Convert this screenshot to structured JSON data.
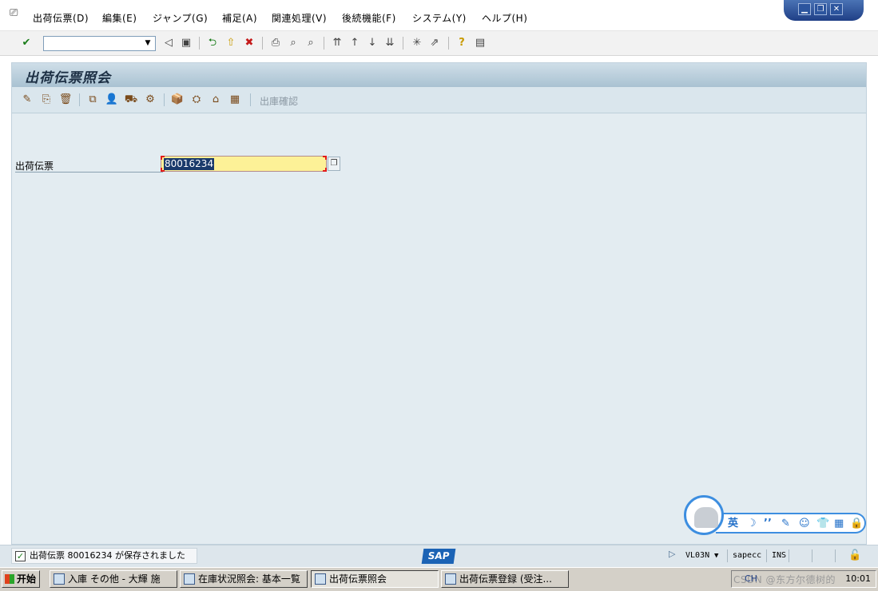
{
  "menubar": {
    "system_icon": "window-menu-icon",
    "items": [
      {
        "label": "出荷伝票(D)"
      },
      {
        "label": "編集(E)"
      },
      {
        "label": "ジャンプ(G)"
      },
      {
        "label": "補足(A)"
      },
      {
        "label": "関連処理(V)"
      },
      {
        "label": "後続機能(F)"
      },
      {
        "label": "システム(Y)"
      },
      {
        "label": "ヘルプ(H)"
      }
    ],
    "window_controls": {
      "minimize": "▁",
      "restore": "❐",
      "close": "✕"
    }
  },
  "toolbar": {
    "enter": "✔",
    "command_value": "",
    "dropdown_arrow": "▼",
    "back_triangle": "◁",
    "save": "▣",
    "back": "⮌",
    "exit": "⇧",
    "cancel": "✖",
    "print": "⎙",
    "find": "⌕",
    "find_next": "⌕",
    "first_page": "⇈",
    "prev_page": "↑",
    "next_page": "↓",
    "last_page": "⇊",
    "new_session": "✳",
    "shortcut": "⇗",
    "help": "?",
    "layout": "▤"
  },
  "screen": {
    "title": "出荷伝票照会",
    "app_toolbar": {
      "icons": [
        "✎",
        "⎘",
        "🗑",
        "⧉",
        "👤",
        "⛟",
        "⚙",
        "📦",
        "⛭",
        "⌂",
        "▦"
      ],
      "disabled_label": "出庫確認"
    },
    "field": {
      "label": "出荷伝票",
      "value": "80016234",
      "help_icon": "❐"
    }
  },
  "ime": {
    "lang": "英",
    "icons": [
      "☽",
      "’’",
      "✎",
      "☺",
      "👕",
      "▦",
      "🔒"
    ]
  },
  "statusbar": {
    "message": "出荷伝票 80016234 が保存されました",
    "logo": "SAP",
    "transaction": "VL03N",
    "dropdown": "▼",
    "server": "sapecc",
    "mode": "INS",
    "lock_icon": "🔓"
  },
  "taskbar": {
    "start_label": "开始",
    "tasks": [
      {
        "label": "入庫 その他 - 大輝 施",
        "active": false
      },
      {
        "label": "在庫状況照会: 基本一覧",
        "active": false
      },
      {
        "label": "出荷伝票照会",
        "active": true
      },
      {
        "label": "出荷伝票登録 (受注...",
        "active": false
      }
    ],
    "tray_watermark": "CSDN @东方尔德树的",
    "clock": "10:01",
    "lang_badge": "CH"
  }
}
